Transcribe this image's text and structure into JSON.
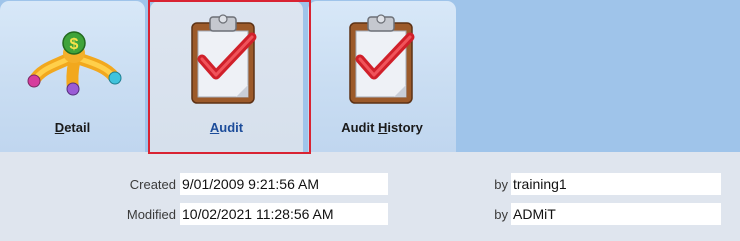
{
  "tabs": [
    {
      "label_underline": "D",
      "label_rest": "etail",
      "icon": "money-hand-icon"
    },
    {
      "label_underline": "A",
      "label_rest": "udit",
      "icon": "clipboard-check-icon",
      "selected": true
    },
    {
      "label_prefix": "Audit ",
      "label_underline": "H",
      "label_rest": "istory",
      "icon": "clipboard-check-icon"
    }
  ],
  "fields": {
    "created_label": "Created",
    "created_value": "9/01/2009 9:21:56 AM",
    "created_by_label": "by",
    "created_by_value": "training1",
    "modified_label": "Modified",
    "modified_value": "10/02/2021 11:28:56 AM",
    "modified_by_label": "by",
    "modified_by_value": "ADMiT"
  },
  "colors": {
    "selection_outline": "#d92332",
    "tabbar_background": "#9fc4ea",
    "active_label": "#1c4c9a"
  }
}
